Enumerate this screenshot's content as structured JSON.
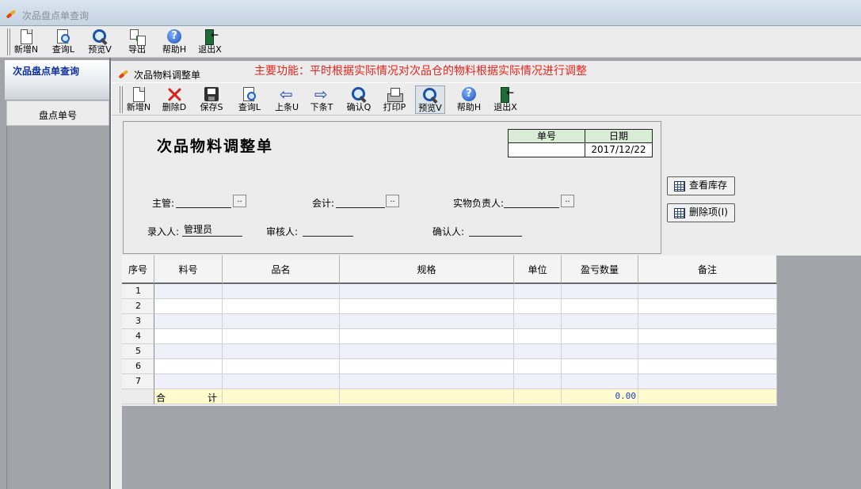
{
  "outer_window": {
    "title": "次品盘点单查询"
  },
  "outer_toolbar": [
    {
      "key": "new",
      "label": "新增N",
      "icon": "new-doc-icon"
    },
    {
      "key": "query",
      "label": "查询L",
      "icon": "query-doc-icon"
    },
    {
      "key": "preview",
      "label": "预览V",
      "icon": "magnifier-icon"
    },
    {
      "key": "export",
      "label": "导出",
      "icon": "export-icon"
    },
    {
      "key": "help",
      "label": "帮助H",
      "icon": "help-icon"
    },
    {
      "key": "exit",
      "label": "退出X",
      "icon": "exit-icon"
    }
  ],
  "left_panel": {
    "title": "次品盘点单查询",
    "column_header": "盘点单号"
  },
  "inner_window": {
    "title": "次品物料调整单",
    "notice": "主要功能：平时根据实际情况对次品仓的物料根据实际情况进行调整"
  },
  "inner_toolbar": [
    {
      "key": "new",
      "label": "新增N",
      "icon": "new-doc-icon"
    },
    {
      "key": "delete",
      "label": "删除D",
      "icon": "delete-x-icon"
    },
    {
      "key": "save",
      "label": "保存S",
      "icon": "save-icon"
    },
    {
      "key": "query",
      "label": "查询L",
      "icon": "query-doc-icon"
    },
    {
      "key": "prev",
      "label": "上条U",
      "icon": "arrow-left-icon"
    },
    {
      "key": "next",
      "label": "下条T",
      "icon": "arrow-right-icon"
    },
    {
      "key": "confirm",
      "label": "确认Q",
      "icon": "magnifier-icon"
    },
    {
      "key": "print",
      "label": "打印P",
      "icon": "printer-icon"
    },
    {
      "key": "preview",
      "label": "预览V",
      "icon": "magnifier-icon"
    },
    {
      "key": "help",
      "label": "帮助H",
      "icon": "help-icon"
    },
    {
      "key": "exit",
      "label": "退出X",
      "icon": "exit-icon"
    }
  ],
  "form": {
    "doc_title": "次品物料调整单",
    "header_table": {
      "number_label": "单号",
      "number_value": "",
      "date_label": "日期",
      "date_value": "2017/12/22"
    },
    "supervisor_label": "主管:",
    "supervisor_value": "",
    "accountant_label": "会计:",
    "accountant_value": "",
    "custodian_label": "实物负责人:",
    "custodian_value": "",
    "entered_by_label": "录入人:",
    "entered_by_value": "管理员",
    "reviewer_label": "审核人:",
    "reviewer_value": "",
    "confirmer_label": "确认人:",
    "confirmer_value": "",
    "lookup_button": ".."
  },
  "side_buttons": {
    "view_stock": "查看库存",
    "delete_item": "删除项(I)"
  },
  "grid": {
    "columns": [
      "序号",
      "料号",
      "品名",
      "规格",
      "单位",
      "盈亏数量",
      "备注"
    ],
    "rows": [
      "1",
      "2",
      "3",
      "4",
      "5",
      "6",
      "7"
    ],
    "total_label_left": "合",
    "total_label_right": "计",
    "total_quantity": "0.00"
  },
  "colors": {
    "notice": "#e8231b",
    "left_title": "#0a2fa5",
    "total_row": "#fffbcf",
    "total_value": "#1a3dbf"
  }
}
